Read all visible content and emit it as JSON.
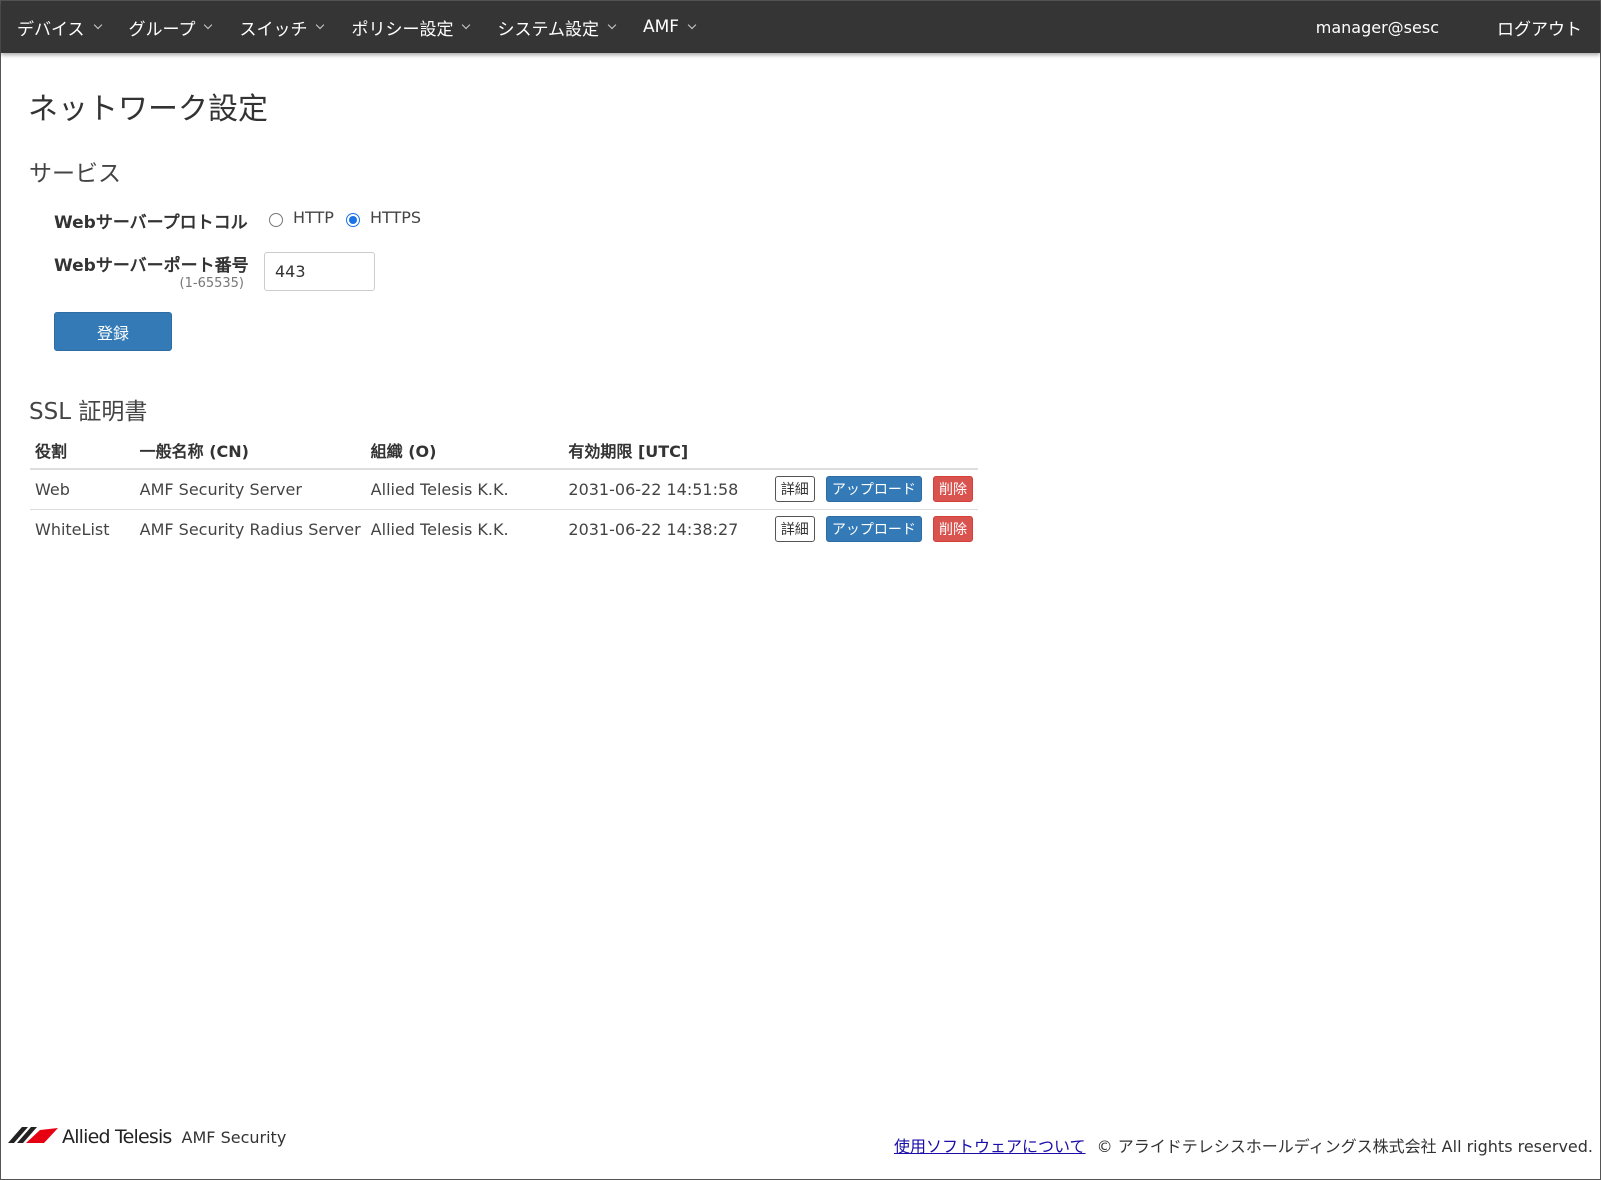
{
  "nav": {
    "items": [
      {
        "label": "デバイス"
      },
      {
        "label": "グループ"
      },
      {
        "label": "スイッチ"
      },
      {
        "label": "ポリシー設定"
      },
      {
        "label": "システム設定"
      },
      {
        "label": "AMF"
      }
    ],
    "user": "manager@sesc",
    "logout": "ログアウト"
  },
  "page": {
    "title": "ネットワーク設定"
  },
  "service": {
    "title": "サービス",
    "protocol_label": "Webサーバープロトコル",
    "protocol_options": [
      "HTTP",
      "HTTPS"
    ],
    "protocol_selected": "HTTPS",
    "port_label": "Webサーバーポート番号",
    "port_range": "(1-65535)",
    "port_value": "443",
    "register_label": "登録"
  },
  "ssl": {
    "title": "SSL 証明書",
    "columns": [
      "役割",
      "一般名称 (CN)",
      "組織 (O)",
      "有効期限 [UTC]"
    ],
    "rows": [
      {
        "role": "Web",
        "cn": "AMF Security Server",
        "org": "Allied Telesis K.K.",
        "expiry": "2031-06-22 14:51:58"
      },
      {
        "role": "WhiteList",
        "cn": "AMF Security Radius Server",
        "org": "Allied Telesis K.K.",
        "expiry": "2031-06-22 14:38:27"
      }
    ],
    "actions": {
      "detail": "詳細",
      "upload": "アップロード",
      "delete": "削除"
    }
  },
  "footer": {
    "logo_text": "Allied Telesis",
    "product": "AMF Security",
    "link": "使用ソフトウェアについて",
    "copyright": "© アライドテレシスホールディングス株式会社 All rights reserved."
  },
  "colors": {
    "navbar": "#353535",
    "primary": "#337ab7",
    "danger": "#d9534f",
    "logo_red": "#e60012"
  }
}
